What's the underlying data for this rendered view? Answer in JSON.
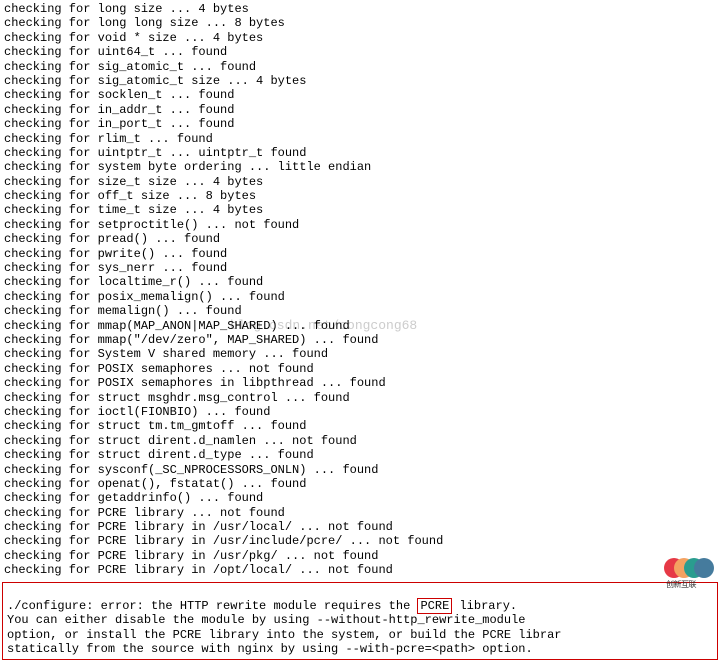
{
  "watermark": "blog.csdn.net/congcong68",
  "lines": [
    "checking for long size ... 4 bytes",
    "checking for long long size ... 8 bytes",
    "checking for void * size ... 4 bytes",
    "checking for uint64_t ... found",
    "checking for sig_atomic_t ... found",
    "checking for sig_atomic_t size ... 4 bytes",
    "checking for socklen_t ... found",
    "checking for in_addr_t ... found",
    "checking for in_port_t ... found",
    "checking for rlim_t ... found",
    "checking for uintptr_t ... uintptr_t found",
    "checking for system byte ordering ... little endian",
    "checking for size_t size ... 4 bytes",
    "checking for off_t size ... 8 bytes",
    "checking for time_t size ... 4 bytes",
    "checking for setproctitle() ... not found",
    "checking for pread() ... found",
    "checking for pwrite() ... found",
    "checking for sys_nerr ... found",
    "checking for localtime_r() ... found",
    "checking for posix_memalign() ... found",
    "checking for memalign() ... found",
    "checking for mmap(MAP_ANON|MAP_SHARED) ... found",
    "checking for mmap(\"/dev/zero\", MAP_SHARED) ... found",
    "checking for System V shared memory ... found",
    "checking for POSIX semaphores ... not found",
    "checking for POSIX semaphores in libpthread ... found",
    "checking for struct msghdr.msg_control ... found",
    "checking for ioctl(FIONBIO) ... found",
    "checking for struct tm.tm_gmtoff ... found",
    "checking for struct dirent.d_namlen ... not found",
    "checking for struct dirent.d_type ... found",
    "checking for sysconf(_SC_NPROCESSORS_ONLN) ... found",
    "checking for openat(), fstatat() ... found",
    "checking for getaddrinfo() ... found",
    "checking for PCRE library ... not found",
    "checking for PCRE library in /usr/local/ ... not found",
    "checking for PCRE library in /usr/include/pcre/ ... not found",
    "checking for PCRE library in /usr/pkg/ ... not found",
    "checking for PCRE library in /opt/local/ ... not found"
  ],
  "error": {
    "line1_pre": "./configure: error: the HTTP rewrite module requires the ",
    "line1_boxed": "PCRE",
    "line1_post": " library.",
    "line2": "You can either disable the module by using --without-http_rewrite_module",
    "line3": "option, or install the PCRE library into the system, or build the PCRE librar",
    "line4": "statically from the source with nginx by using --with-pcre=<path> option."
  },
  "logo_text": "创新互联"
}
